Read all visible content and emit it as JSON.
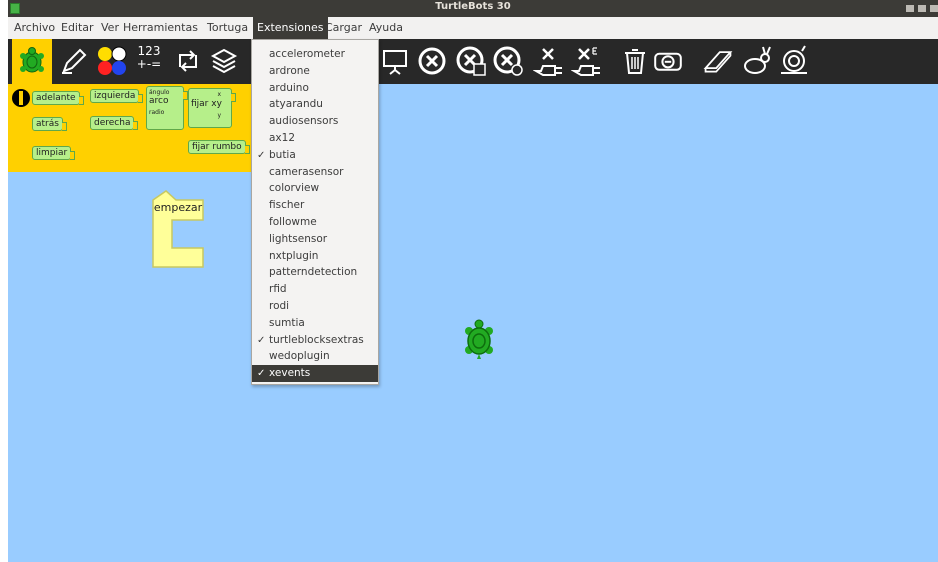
{
  "window": {
    "title": "TurtleBots 30",
    "colors": {
      "titlebar": "#3c3b37",
      "menubar": "#f2f1f0",
      "toolbar": "#282828",
      "palette": "#ffd000",
      "canvas": "#99ccff",
      "block": "#b6ef8a",
      "start_block": "#ffff99",
      "turtle": "#22aa22"
    }
  },
  "menubar": {
    "items": [
      "Archivo",
      "Editar",
      "Ver",
      "Herramientas",
      "Tortuga",
      "Extensiones",
      "Cargar",
      "Ayuda"
    ],
    "active": "Extensiones"
  },
  "toolbar": {
    "icons": [
      "turtle-palette-icon",
      "pen-icon",
      "colors-icon",
      "numbers-icon",
      "flow-icon",
      "blocks-icon",
      "presentation-icon",
      "stop-icon",
      "stop-edit-icon",
      "stop-camera-icon",
      "plug-x-icon",
      "plug-x-e-icon",
      "trash-icon",
      "camera-minus-icon",
      "eraser-icon",
      "rabbit-icon",
      "snail-icon"
    ],
    "number_icon_text": {
      "line1": "123",
      "line2": "+-="
    }
  },
  "palette": {
    "blocks": {
      "adelante": "adelante",
      "izquierda": "izquierda",
      "angulo": "ángulo",
      "arco": "arco",
      "radio": "radio",
      "x": "x",
      "fijar_xy": "fijar xy",
      "y": "y",
      "atras": "atrás",
      "derecha": "derecha",
      "limpiar": "limpiar",
      "fijar_rumbo": "fijar rumbo"
    }
  },
  "canvas": {
    "start_block_label": "empezar"
  },
  "extensions_menu": {
    "items": [
      {
        "label": "accelerometer",
        "checked": false
      },
      {
        "label": "ardrone",
        "checked": false
      },
      {
        "label": "arduino",
        "checked": false
      },
      {
        "label": "atyarandu",
        "checked": false
      },
      {
        "label": "audiosensors",
        "checked": false
      },
      {
        "label": "ax12",
        "checked": false
      },
      {
        "label": "butia",
        "checked": true
      },
      {
        "label": "camerasensor",
        "checked": false
      },
      {
        "label": "colorview",
        "checked": false
      },
      {
        "label": "fischer",
        "checked": false
      },
      {
        "label": "followme",
        "checked": false
      },
      {
        "label": "lightsensor",
        "checked": false
      },
      {
        "label": "nxtplugin",
        "checked": false
      },
      {
        "label": "patterndetection",
        "checked": false
      },
      {
        "label": "rfid",
        "checked": false
      },
      {
        "label": "rodi",
        "checked": false
      },
      {
        "label": "sumtia",
        "checked": false
      },
      {
        "label": "turtleblocksextras",
        "checked": true
      },
      {
        "label": "wedoplugin",
        "checked": false
      },
      {
        "label": "xevents",
        "checked": true,
        "highlighted": true
      }
    ],
    "check_glyph": "✓"
  }
}
